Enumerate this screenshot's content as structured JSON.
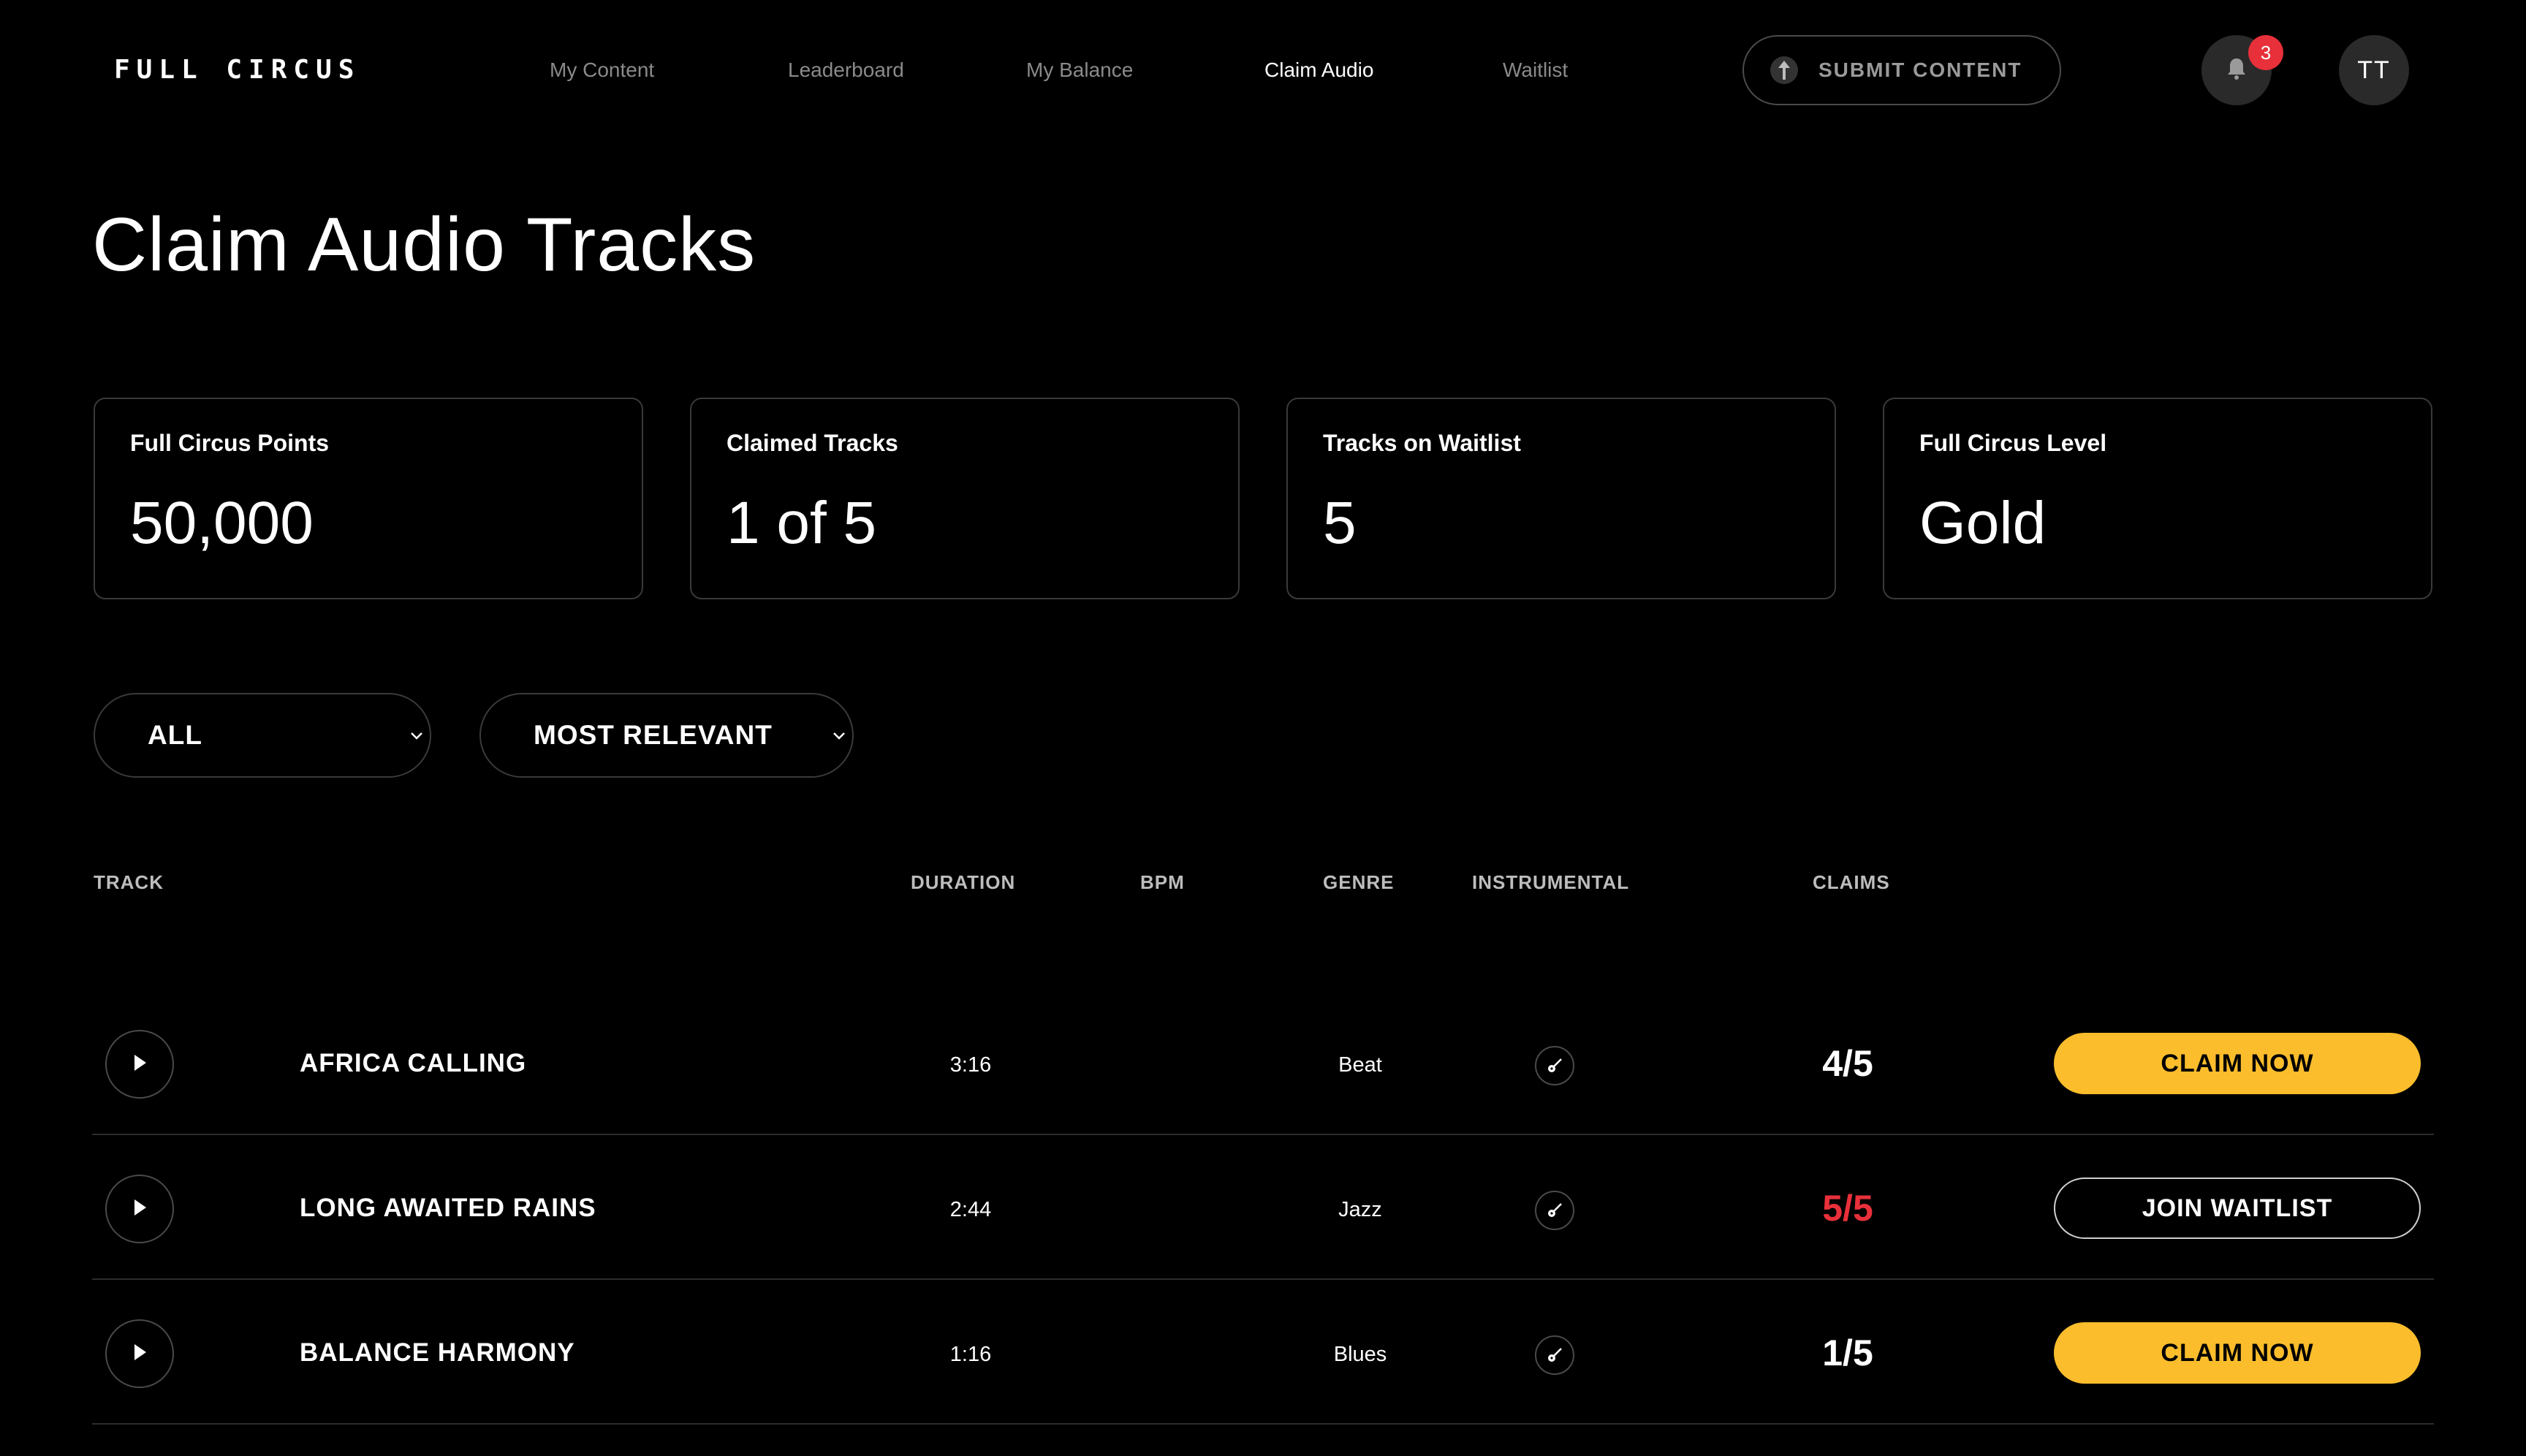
{
  "header": {
    "logo": "FULL CIRCUS",
    "nav": [
      {
        "label": "My Content",
        "active": false
      },
      {
        "label": "Leaderboard",
        "active": false
      },
      {
        "label": "My Balance",
        "active": false
      },
      {
        "label": "Claim Audio",
        "active": true
      },
      {
        "label": "Waitlist",
        "active": false
      }
    ],
    "submit_label": "SUBMIT CONTENT",
    "submit_icon": "upload-arrow-icon",
    "notification_icon": "bell-icon",
    "notification_count": "3",
    "avatar_initials": "TT"
  },
  "main": {
    "title": "Claim Audio Tracks",
    "stats": [
      {
        "label": "Full Circus Points",
        "value": "50,000"
      },
      {
        "label": "Claimed Tracks",
        "value": "1 of 5"
      },
      {
        "label": "Tracks on Waitlist",
        "value": "5"
      },
      {
        "label": "Full Circus Level",
        "value": "Gold"
      }
    ],
    "filters": {
      "category": "ALL",
      "sort": "MOST RELEVANT",
      "chevron_icon": "chevron-down-icon"
    },
    "table": {
      "columns": {
        "track": "TRACK",
        "duration": "DURATION",
        "bpm": "BPM",
        "genre": "GENRE",
        "instrumental": "INSTRUMENTAL",
        "claims": "CLAIMS"
      },
      "rows": [
        {
          "name": "AFRICA CALLING",
          "duration": "3:16",
          "bpm": "",
          "genre": "Beat",
          "instrumental_icon": "guitar-icon",
          "claims": "4/5",
          "claims_full": false,
          "action": "CLAIM NOW"
        },
        {
          "name": "LONG AWAITED RAINS",
          "duration": "2:44",
          "bpm": "",
          "genre": "Jazz",
          "instrumental_icon": "guitar-icon",
          "claims": "5/5",
          "claims_full": true,
          "action": "JOIN WAITLIST"
        },
        {
          "name": "BALANCE HARMONY",
          "duration": "1:16",
          "bpm": "",
          "genre": "Blues",
          "instrumental_icon": "guitar-icon",
          "claims": "1/5",
          "claims_full": false,
          "action": "CLAIM NOW"
        }
      ]
    }
  },
  "colors": {
    "background": "#000000",
    "accent": "#fbbd2c",
    "alert": "#e8303a",
    "muted_text": "#8a8a8a",
    "border": "#3a3a3a"
  }
}
